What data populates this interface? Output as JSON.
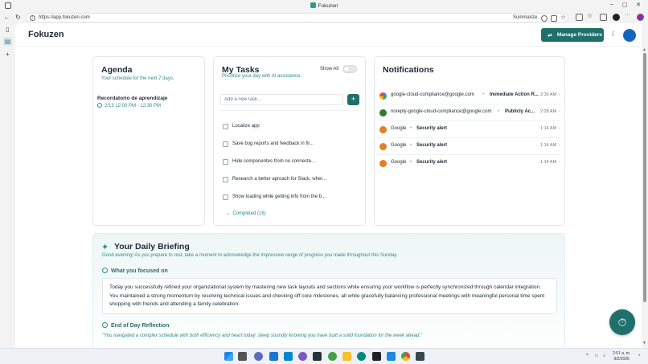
{
  "browser": {
    "window_title": "Fokuzen",
    "url": "https://app.fokuzen.com",
    "summarize_label": "Summarize"
  },
  "app": {
    "brand": "Fokuzen",
    "manage_providers_label": "Manage Providers"
  },
  "agenda": {
    "title": "Agenda",
    "subtitle": "Your schedule for the next 7 days.",
    "events": [
      {
        "title": "Recordatorio de aprendizaje",
        "time": "2/13 12:00 PM - 12:30 PM"
      }
    ]
  },
  "tasks": {
    "title": "My Tasks",
    "subtitle": "Prioritize your day with AI assistance.",
    "show_all_label": "Show All",
    "show_all_enabled": false,
    "add_placeholder": "Add a new task...",
    "add_button": "+",
    "items": [
      {
        "label": "Localize app",
        "checked": false
      },
      {
        "label": "Save bug reports and feedback in fir...",
        "checked": false
      },
      {
        "label": "Hide componentes from no connecte...",
        "checked": false
      },
      {
        "label": "Research a better aproach for Slack, wher...",
        "checked": false
      },
      {
        "label": "Show loading while getting info from the b...",
        "checked": false
      }
    ],
    "completed_label": "Completed (16)"
  },
  "notifications": {
    "title": "Notifications",
    "items": [
      {
        "sender": "google-cloud-compliance@google.com",
        "subject": "Immediate Action R...",
        "time": "2:30 AM",
        "icon": "google-cloud-icon"
      },
      {
        "sender": "noreply-google-cloud-compliance@google.com",
        "subject": "Publicly Ac...",
        "time": "2:28 AM",
        "icon": "google-cloud-icon"
      },
      {
        "sender": "Google",
        "subject": "Security alert",
        "time": "1:14 AM",
        "icon": "google-account-icon"
      },
      {
        "sender": "Google",
        "subject": "Security alert",
        "time": "1:14 AM",
        "icon": "google-account-icon"
      },
      {
        "sender": "Google",
        "subject": "Security alert",
        "time": "1:14 AM",
        "icon": "google-account-icon"
      }
    ]
  },
  "briefing": {
    "title": "Your Daily Briefing",
    "greeting": "Good evening! As you prepare to rest, take a moment to acknowledge the impressive range of progress you made throughout this Sunday.",
    "focus_heading": "What you focused on",
    "focus_text": "Today you successfully refined your organizational system by mastering new task layouts and sections while ensuring your workflow is perfectly synchronized through calendar integration. You maintained a strong momentum by resolving technical issues and checking off core milestones, all while gracefully balancing professional meetings with meaningful personal time spent shopping with friends and attending a family celebration.",
    "reflection_heading": "End of Day Reflection",
    "reflection_text": "\"You navigated a complex schedule with both efficiency and heart today; sleep soundly knowing you have built a solid foundation for the week ahead.\""
  },
  "taskbar": {
    "time": "2:51 a. m.",
    "date": "9/2/2026"
  },
  "colors": {
    "accent": "#1f6f6a",
    "accent_text": "#2a8c84",
    "avatar": "#1565c0"
  }
}
